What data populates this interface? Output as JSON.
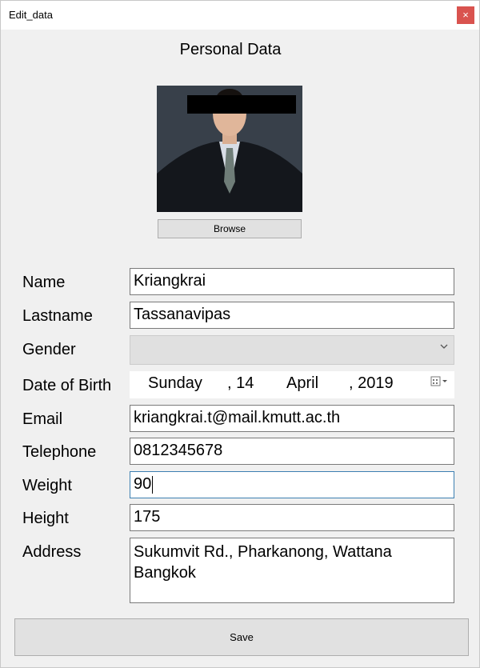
{
  "window": {
    "title": "Edit_data",
    "close_label": "×"
  },
  "heading": "Personal Data",
  "browse_label": "Browse",
  "fields": {
    "name": {
      "label": "Name",
      "value": "Kriangkrai"
    },
    "lastname": {
      "label": "Lastname",
      "value": "Tassanavipas"
    },
    "gender": {
      "label": "Gender",
      "value": ""
    },
    "dob": {
      "label": "Date of Birth",
      "weekday": "Sunday",
      "day": ", 14",
      "month": "April",
      "year": ", 2019"
    },
    "email": {
      "label": "Email",
      "value": "kriangkrai.t@mail.kmutt.ac.th"
    },
    "telephone": {
      "label": "Telephone",
      "value": "0812345678"
    },
    "weight": {
      "label": "Weight",
      "value": "90"
    },
    "height": {
      "label": "Height",
      "value": "175"
    },
    "address": {
      "label": "Address",
      "line1": "Sukumvit Rd., Pharkanong, Wattana",
      "line2": "Bangkok"
    }
  },
  "save_label": "Save",
  "colors": {
    "close": "#d9534f",
    "focus_border": "#3c7fb1",
    "button": "#e1e1e1"
  },
  "icons": {
    "close": "close-icon",
    "dropdown": "chevron-down-icon",
    "calendar": "calendar-icon"
  }
}
